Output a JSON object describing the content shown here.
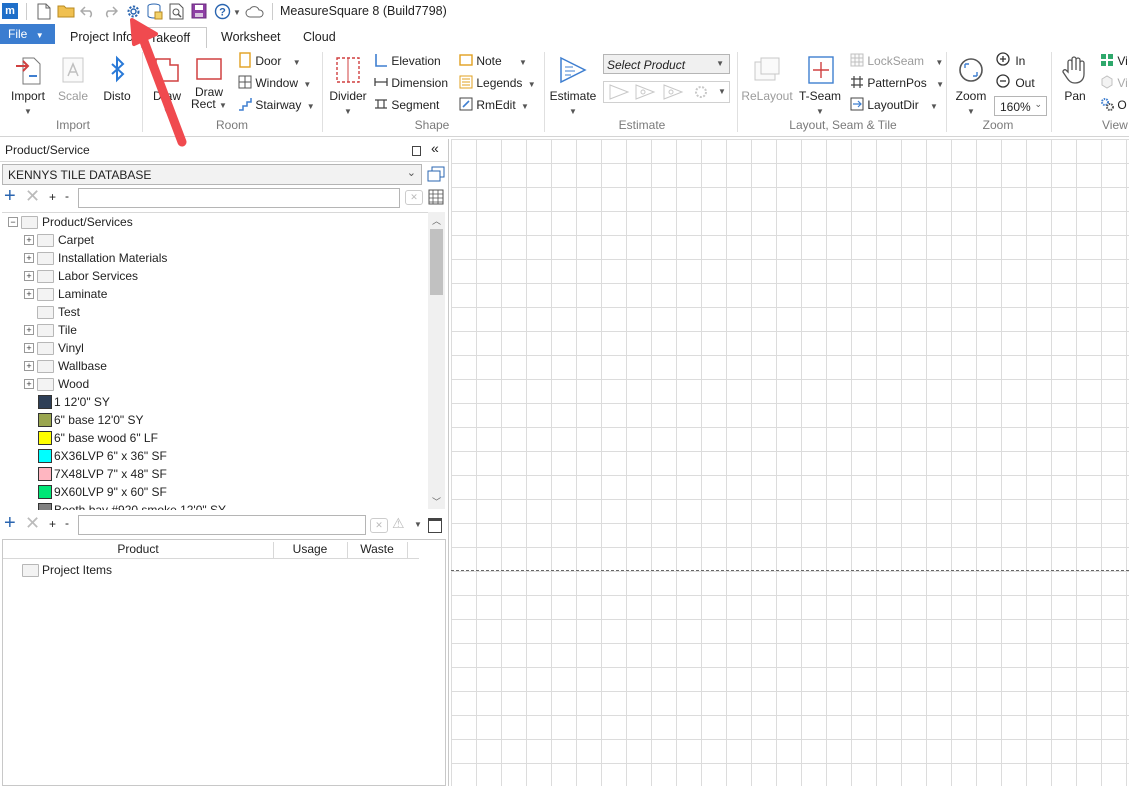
{
  "title": "MeasureSquare 8 (Build7798)",
  "tabs": {
    "file": "File",
    "items": [
      "Project Info",
      "Takeoff",
      "Worksheet",
      "Cloud"
    ]
  },
  "ribbon": {
    "import_group": {
      "label": "Import",
      "import": "Import",
      "scale": "Scale",
      "disto": "Disto"
    },
    "room_group": {
      "label": "Room",
      "draw": "Draw",
      "draw_rect_1": "Draw",
      "draw_rect_2": "Rect",
      "door": "Door",
      "window": "Window",
      "stairway": "Stairway"
    },
    "shape_group": {
      "label": "Shape",
      "divider": "Divider",
      "elevation": "Elevation",
      "dimension": "Dimension",
      "segment": "Segment",
      "note": "Note",
      "legends": "Legends",
      "rmedit": "RmEdit"
    },
    "estimate_group": {
      "label": "Estimate",
      "estimate": "Estimate",
      "select_product": "Select Product"
    },
    "layout_group": {
      "label": "Layout, Seam & Tile",
      "relayout": "ReLayout",
      "tseam": "T-Seam",
      "lockseam": "LockSeam",
      "patternpos": "PatternPos",
      "layoutdir": "LayoutDir"
    },
    "zoom_group": {
      "label": "Zoom",
      "zoom": "Zoom",
      "in": "In",
      "out": "Out",
      "zoom_level": "160%"
    },
    "view_group": {
      "label": "View",
      "pan": "Pan",
      "vi1": "Vi",
      "vi2": "Vi",
      "o": "O"
    }
  },
  "product_panel": {
    "title": "Product/Service",
    "database": "KENNYS TILE DATABASE",
    "search_placeholder": "",
    "tree": {
      "root": "Product/Services",
      "folders": [
        "Carpet",
        "Installation Materials",
        "Labor Services",
        "Laminate",
        "Test",
        "Tile",
        "Vinyl",
        "Wallbase",
        "Wood"
      ],
      "products": [
        {
          "label": "1 12'0\" SY",
          "color": "#2e3f57"
        },
        {
          "label": "6\" base 12'0\" SY",
          "color": "#9aa650"
        },
        {
          "label": "6\" base wood 6\" LF",
          "color": "#ffff00"
        },
        {
          "label": "6X36LVP 6\" x 36\" SF",
          "color": "#00ffff"
        },
        {
          "label": "7X48LVP 7\" x 48\" SF",
          "color": "#ffb6c1"
        },
        {
          "label": "9X60LVP 9\" x 60\" SF",
          "color": "#00e676"
        },
        {
          "label": "Booth bay #920 smoke 12'0\" SY",
          "color": "#808080"
        }
      ]
    }
  },
  "project_panel": {
    "columns": [
      "Product",
      "Usage",
      "Waste"
    ],
    "root": "Project Items"
  },
  "colors": {
    "accent": "#3b7dd0",
    "annotation_arrow": "#f04a4f"
  }
}
